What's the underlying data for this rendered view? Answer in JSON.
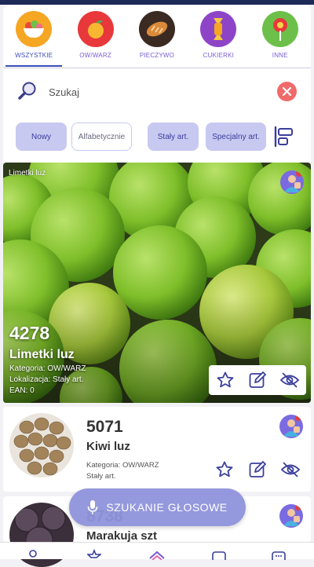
{
  "categories": [
    {
      "label": "WSZYSTKIE",
      "icon": "salad-bowl-icon",
      "active": true
    },
    {
      "label": "OW/WARZ",
      "icon": "orange-fruit-icon",
      "active": false
    },
    {
      "label": "PIECZYWO",
      "icon": "bread-icon",
      "active": false
    },
    {
      "label": "CUKIERKI",
      "icon": "candy-icon",
      "active": false
    },
    {
      "label": "INNE",
      "icon": "lollipop-icon",
      "active": false
    }
  ],
  "search": {
    "placeholder": "Szukaj"
  },
  "filters": {
    "new_label": "Nowy",
    "alpha_label": "Alfabetycznie",
    "fixed_label": "Stały art.",
    "special_label": "Specjalny art."
  },
  "hero": {
    "tag": "Limetki luz",
    "number": "4278",
    "name": "Limetki luz",
    "category": "Kategoria: OW/WARZ",
    "location": "Lokalizacja: Stały art.",
    "ean": "EAN: 0"
  },
  "items": [
    {
      "number": "5071",
      "name": "Kiwi luz",
      "category": "Kategoria: OW/WARZ",
      "location": "Stały art."
    },
    {
      "number": "8738",
      "name": "Marakuja szt"
    }
  ],
  "voice": {
    "label": "SZUKANIE GŁOSOWE"
  },
  "colors": {
    "accent": "#3b4db8",
    "chip": "#c8c9f1",
    "voice": "#8f93dc",
    "clear": "#f06a6a",
    "icon": "#3a3e9c"
  }
}
